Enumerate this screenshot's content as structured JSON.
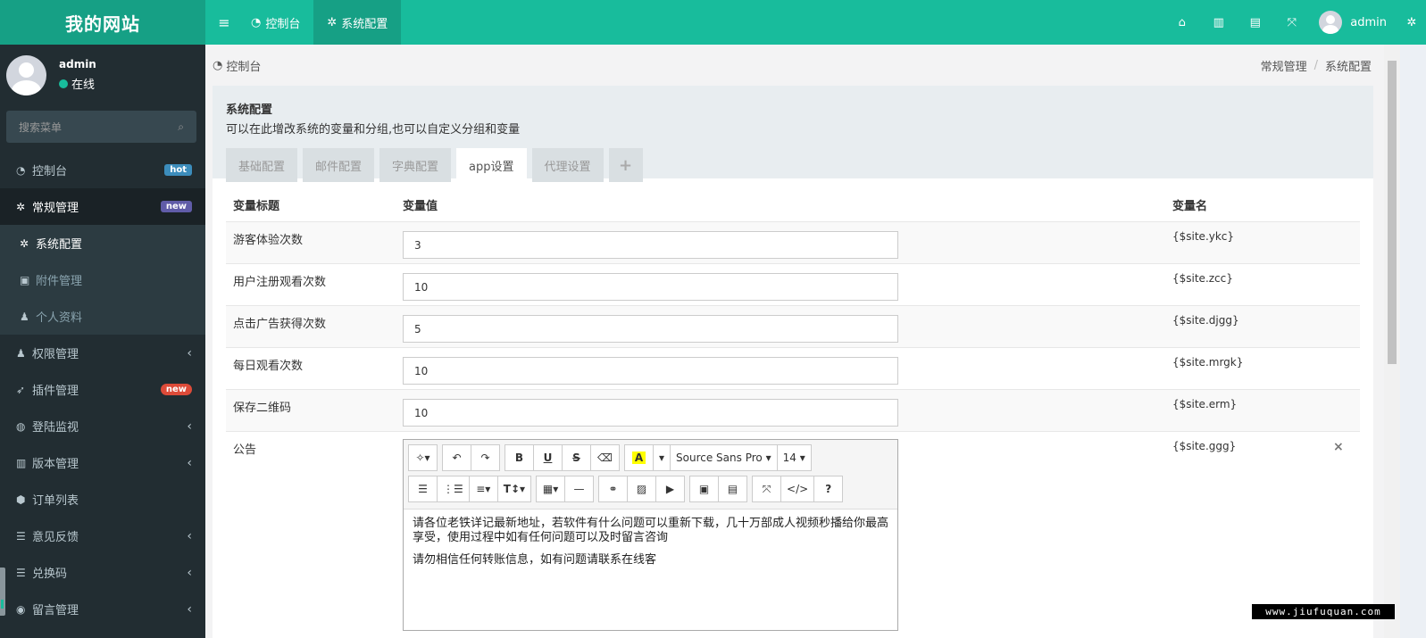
{
  "app": {
    "logo": "我的网站"
  },
  "topbar": {
    "tabs": [
      {
        "icon": "dashboard-icon",
        "label": "控制台"
      },
      {
        "icon": "gear-icon",
        "label": "系统配置"
      }
    ],
    "user": "admin"
  },
  "sidebar": {
    "user_name": "admin",
    "status": "在线",
    "search_placeholder": "搜索菜单",
    "items": [
      {
        "label": "控制台",
        "badge": "hot"
      },
      {
        "label": "常规管理",
        "badge": "new"
      },
      {
        "label": "系统配置"
      },
      {
        "label": "附件管理"
      },
      {
        "label": "个人资料"
      },
      {
        "label": "权限管理"
      },
      {
        "label": "插件管理",
        "badge": "new"
      },
      {
        "label": "登陆监视"
      },
      {
        "label": "版本管理"
      },
      {
        "label": "订单列表"
      },
      {
        "label": "意见反馈"
      },
      {
        "label": "兑换码"
      },
      {
        "label": "留言管理"
      }
    ]
  },
  "breadcrumb": {
    "left": "控制台",
    "right": [
      "常规管理",
      "系统配置"
    ]
  },
  "panel": {
    "title": "系统配置",
    "description": "可以在此增改系统的变量和分组,也可以自定义分组和变量",
    "tabs": [
      "基础配置",
      "邮件配置",
      "字典配置",
      "app设置",
      "代理设置"
    ],
    "add_tab": "+"
  },
  "table": {
    "headers": [
      "变量标题",
      "变量值",
      "变量名"
    ],
    "rows": [
      {
        "title": "游客体验次数",
        "value": "3",
        "name": "{$site.ykc}"
      },
      {
        "title": "用户注册观看次数",
        "value": "10",
        "name": "{$site.zcc}"
      },
      {
        "title": "点击广告获得次数",
        "value": "5",
        "name": "{$site.djgg}"
      },
      {
        "title": "每日观看次数",
        "value": "10",
        "name": "{$site.mrgk}"
      },
      {
        "title": "保存二维码",
        "value": "10",
        "name": "{$site.erm}"
      }
    ],
    "notice": {
      "title": "公告",
      "name": "{$site.ggg}",
      "delete": "×",
      "editor": {
        "font": "Source Sans Pro",
        "size": "14",
        "paragraphs": [
          "请各位老铁详记最新地址，若软件有什么问题可以重新下载，几十万部成人视频秒播给你最高享受，使用过程中如有任何问题可以及时留言咨询",
          "请勿相信任何转账信息，如有问题请联系在线客"
        ]
      }
    }
  },
  "watermark": "www.jiufuquan.com"
}
